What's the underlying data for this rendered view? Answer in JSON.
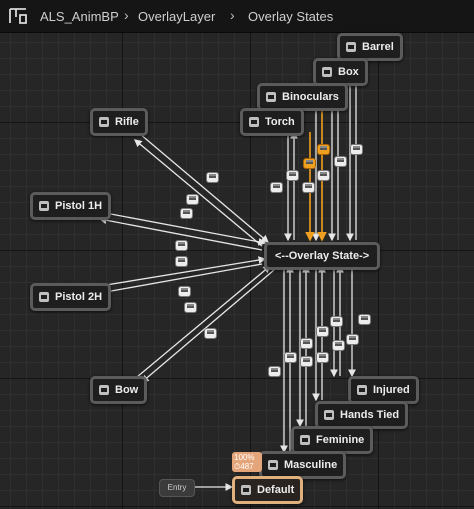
{
  "breadcrumb": {
    "items": [
      "ALS_AnimBP",
      "OverlayLayer",
      "Overlay States"
    ]
  },
  "graph": {
    "entry_label": "Entry",
    "states": {
      "barrel": "Barrel",
      "box": "Box",
      "binoculars": "Binoculars",
      "torch": "Torch",
      "rifle": "Rifle",
      "pistol_1h": "Pistol 1H",
      "pistol_2h": "Pistol 2H",
      "bow": "Bow",
      "overlay_state": "<--Overlay State->",
      "injured": "Injured",
      "hands_tied": "Hands Tied",
      "feminine": "Feminine",
      "masculine": "Masculine",
      "default": "Default"
    },
    "debug_badge": {
      "percent": "100%",
      "time": "⏱487"
    },
    "colors": {
      "grid_bg": "#262626",
      "wire": "#e6e6e6",
      "active_wire": "#f0a020",
      "selected_node_border": "#e0b07e"
    }
  }
}
